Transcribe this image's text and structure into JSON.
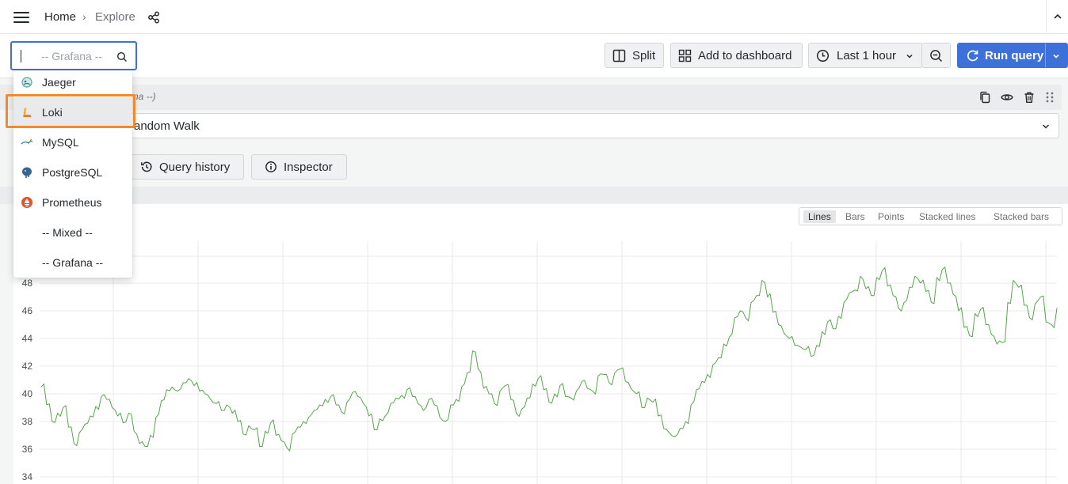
{
  "nav": {
    "home": "Home",
    "separator": "›",
    "current": "Explore"
  },
  "datasource_picker": {
    "placeholder": "-- Grafana --"
  },
  "toolbar": {
    "split": "Split",
    "add_to_dashboard": "Add to dashboard",
    "time_range": "Last 1 hour",
    "run_query": "Run query"
  },
  "query": {
    "datasource_label": "na --)",
    "scenario": "andom Walk"
  },
  "query_actions": {
    "history": "Query history",
    "inspector": "Inspector"
  },
  "viz_options": [
    "Lines",
    "Bars",
    "Points",
    "Stacked lines",
    "Stacked bars"
  ],
  "viz_selected": "Lines",
  "dropdown": {
    "items": [
      {
        "label": "Jaeger",
        "icon": "jaeger-icon"
      },
      {
        "label": "Loki",
        "icon": "loki-icon",
        "highlighted": true
      },
      {
        "label": "MySQL",
        "icon": "mysql-icon"
      },
      {
        "label": "PostgreSQL",
        "icon": "postgresql-icon"
      },
      {
        "label": "Prometheus",
        "icon": "prometheus-icon"
      },
      {
        "label": "-- Mixed --",
        "icon": ""
      },
      {
        "label": "-- Grafana --",
        "icon": ""
      }
    ]
  },
  "colors": {
    "accent": "#3d71d9",
    "series": "#56a64b",
    "highlight": "#f2892c"
  },
  "chart_data": {
    "type": "line",
    "y_ticks": [
      "34",
      "36",
      "38",
      "40",
      "42",
      "44",
      "46",
      "48"
    ],
    "ylim": [
      34,
      50
    ],
    "grid": true,
    "series": [
      {
        "values": [
          40.5,
          39.2,
          38.0,
          38.6,
          39.0,
          37.6,
          36.4,
          37.2,
          37.8,
          38.4,
          39.1,
          39.8,
          39.6,
          39.0,
          38.4,
          37.9,
          38.6,
          37.3,
          36.4,
          36.2,
          37.0,
          38.3,
          39.5,
          40.3,
          40.5,
          40.2,
          40.8,
          41.1,
          40.6,
          40.2,
          40.0,
          39.6,
          39.3,
          38.8,
          39.2,
          38.6,
          38.0,
          37.1,
          37.7,
          37.4,
          36.2,
          37.3,
          37.9,
          37.0,
          36.6,
          36.1,
          37.1,
          37.6,
          38.0,
          38.3,
          38.8,
          39.2,
          39.6,
          39.8,
          39.2,
          38.7,
          39.4,
          40.1,
          39.8,
          39.3,
          38.4,
          37.4,
          38.2,
          38.4,
          39.3,
          39.7,
          39.9,
          40.3,
          39.8,
          39.3,
          38.8,
          39.6,
          39.2,
          38.3,
          38.0,
          39.2,
          39.6,
          40.5,
          41.5,
          43.1,
          41.8,
          40.4,
          40.0,
          39.3,
          40.2,
          40.6,
          39.6,
          38.6,
          38.9,
          39.7,
          40.7,
          41.1,
          40.3,
          39.4,
          40.0,
          40.6,
          39.8,
          39.7,
          40.2,
          40.9,
          40.4,
          40.2,
          41.3,
          41.4,
          40.8,
          41.5,
          41.8,
          40.9,
          40.4,
          40.0,
          39.0,
          39.7,
          39.4,
          38.4,
          37.5,
          37.2,
          36.9,
          37.5,
          38.0,
          39.2,
          40.3,
          40.9,
          41.4,
          42.1,
          42.6,
          43.6,
          44.1,
          45.5,
          46.0,
          45.5,
          46.6,
          47.1,
          48.2,
          47.0,
          45.9,
          45.0,
          44.4,
          44.0,
          43.5,
          43.4,
          43.2,
          42.7,
          43.5,
          44.5,
          45.2,
          44.7,
          45.6,
          46.6,
          47.3,
          47.5,
          48.5,
          47.6,
          47.1,
          48.4,
          48.9,
          47.8,
          47.1,
          46.2,
          46.6,
          47.7,
          48.5,
          48.0,
          47.4,
          46.6,
          48.4,
          49.0,
          48.0,
          47.2,
          46.0,
          44.8,
          44.2,
          45.8,
          46.1,
          45.0,
          44.3,
          43.6,
          43.7,
          46.6,
          48.2,
          47.7,
          46.4,
          45.5,
          46.5,
          47.0,
          45.2,
          45.0,
          46.2
        ]
      }
    ]
  }
}
